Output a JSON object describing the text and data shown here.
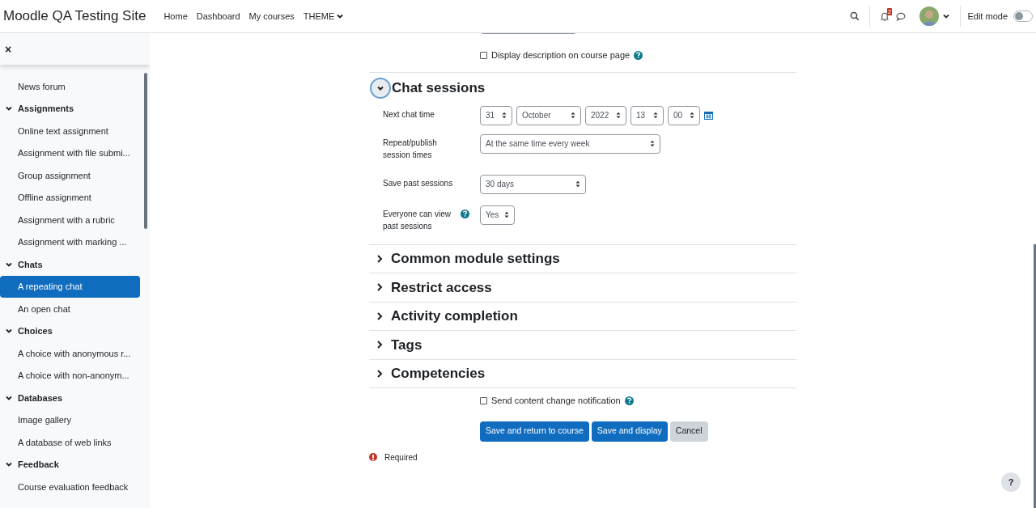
{
  "navbar": {
    "site_name": "Moodle QA Testing Site",
    "links": [
      {
        "label": "Home",
        "dropdown": false
      },
      {
        "label": "Dashboard",
        "dropdown": false
      },
      {
        "label": "My courses",
        "dropdown": false
      },
      {
        "label": "THEME",
        "dropdown": true
      }
    ],
    "notification_count": "2",
    "edit_mode": {
      "label": "Edit mode",
      "on": false
    }
  },
  "drawer": {
    "close": "×",
    "sections": [
      {
        "children": [
          {
            "label": "News forum",
            "selected": false
          }
        ]
      },
      {
        "title": "Assignments",
        "expanded": true,
        "children": [
          {
            "label": "Online text assignment",
            "selected": false
          },
          {
            "label": "Assignment with file submi...",
            "selected": false
          },
          {
            "label": "Group assignment",
            "selected": false
          },
          {
            "label": "Offline assignment",
            "selected": false
          },
          {
            "label": "Assignment with a rubric",
            "selected": false
          },
          {
            "label": "Assignment with marking ...",
            "selected": false
          }
        ]
      },
      {
        "title": "Chats",
        "expanded": true,
        "children": [
          {
            "label": "A repeating chat",
            "selected": true
          },
          {
            "label": "An open chat",
            "selected": false
          }
        ]
      },
      {
        "title": "Choices",
        "expanded": true,
        "children": [
          {
            "label": "A choice with anonymous r...",
            "selected": false
          },
          {
            "label": "A choice with non-anonym...",
            "selected": false
          }
        ]
      },
      {
        "title": "Databases",
        "expanded": true,
        "children": [
          {
            "label": "Image gallery",
            "selected": false
          },
          {
            "label": "A database of web links",
            "selected": false
          }
        ]
      },
      {
        "title": "Feedback",
        "expanded": true,
        "children": [
          {
            "label": "Course evaluation feedback",
            "selected": false
          }
        ]
      }
    ]
  },
  "form": {
    "display_description": {
      "label": "Display description on course page",
      "checked": false
    },
    "chat_sessions": {
      "title": "Chat sessions",
      "expanded": true,
      "fields": [
        {
          "label": "Next chat time",
          "help": false,
          "selects": [
            "31",
            "October",
            "2022",
            "13",
            "00"
          ],
          "calendar": true
        },
        {
          "label": "Repeat/publish session times",
          "help": false,
          "selects": [
            "At the same time every week"
          ]
        },
        {
          "label": "Save past sessions",
          "help": false,
          "selects": [
            "30 days"
          ]
        },
        {
          "label": "Everyone can view past sessions",
          "help": true,
          "selects": [
            "Yes"
          ]
        }
      ]
    },
    "sections": [
      {
        "title": "Common module settings",
        "expanded": false
      },
      {
        "title": "Restrict access",
        "expanded": false
      },
      {
        "title": "Activity completion",
        "expanded": false
      },
      {
        "title": "Tags",
        "expanded": false
      },
      {
        "title": "Competencies",
        "expanded": false
      }
    ],
    "notification": {
      "label": "Send content change notification",
      "checked": false
    },
    "buttons": [
      {
        "label": "Save and return to course",
        "kind": "primary"
      },
      {
        "label": "Save and display",
        "kind": "primary"
      },
      {
        "label": "Cancel",
        "kind": "secondary"
      }
    ],
    "required_note": "Required"
  },
  "help_button": "?"
}
